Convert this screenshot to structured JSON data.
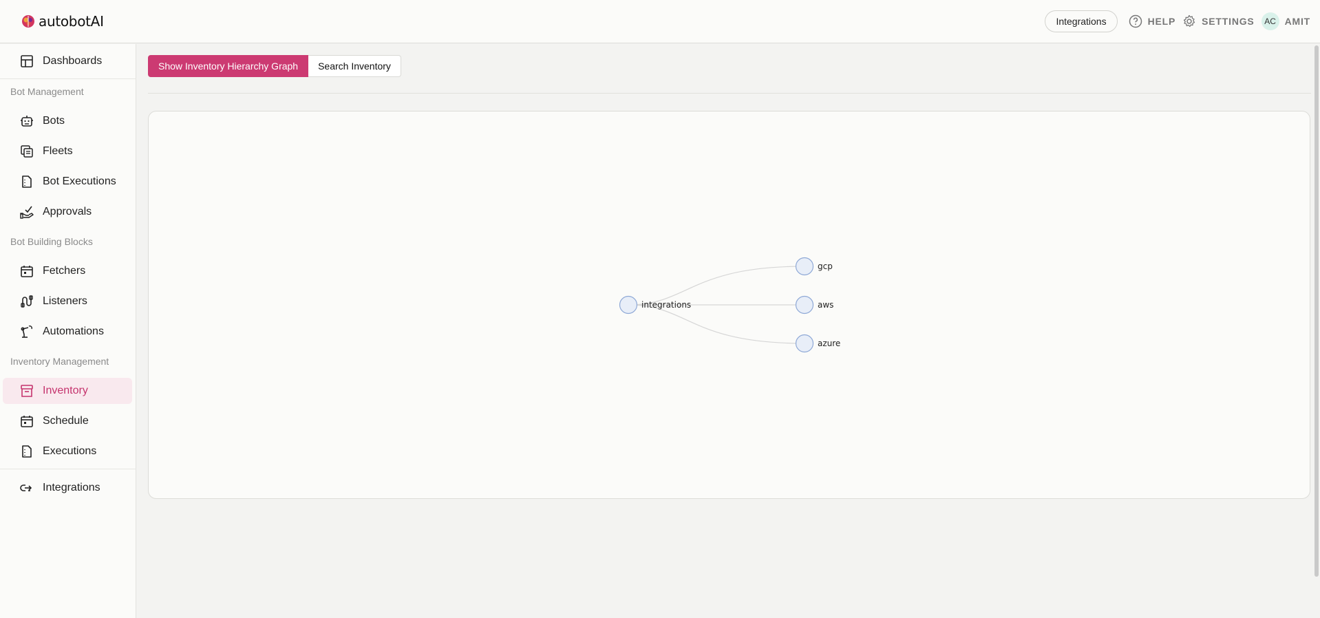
{
  "app": {
    "brand": "autobotAI",
    "brand_color": "#cc3a72"
  },
  "header": {
    "integrations_button": "Integrations",
    "help_label": "HELP",
    "settings_label": "SETTINGS",
    "user_initials": "AC",
    "user_name": "AMIT"
  },
  "sidebar": {
    "items": [
      {
        "label": "Dashboards",
        "icon": "layout-icon"
      },
      {
        "label": "Bots",
        "icon": "robot-icon"
      },
      {
        "label": "Fleets",
        "icon": "fleet-icon"
      },
      {
        "label": "Bot Executions",
        "icon": "file-icon"
      },
      {
        "label": "Approvals",
        "icon": "approval-hand-icon"
      },
      {
        "label": "Fetchers",
        "icon": "calendar-icon"
      },
      {
        "label": "Listeners",
        "icon": "listener-icon"
      },
      {
        "label": "Automations",
        "icon": "robotic-arm-icon"
      },
      {
        "label": "Inventory",
        "icon": "archive-icon",
        "active": true
      },
      {
        "label": "Schedule",
        "icon": "calendar-icon"
      },
      {
        "label": "Executions",
        "icon": "file-icon"
      },
      {
        "label": "Integrations",
        "icon": "integration-icon"
      }
    ],
    "sections": {
      "bot_management": "Bot Management",
      "bot_building_blocks": "Bot Building Blocks",
      "inventory_management": "Inventory Management"
    }
  },
  "main": {
    "tabs": {
      "graph": "Show Inventory Hierarchy Graph",
      "search": "Search Inventory"
    },
    "graph": {
      "root": "integrations",
      "children": [
        "gcp",
        "aws",
        "azure"
      ]
    }
  }
}
